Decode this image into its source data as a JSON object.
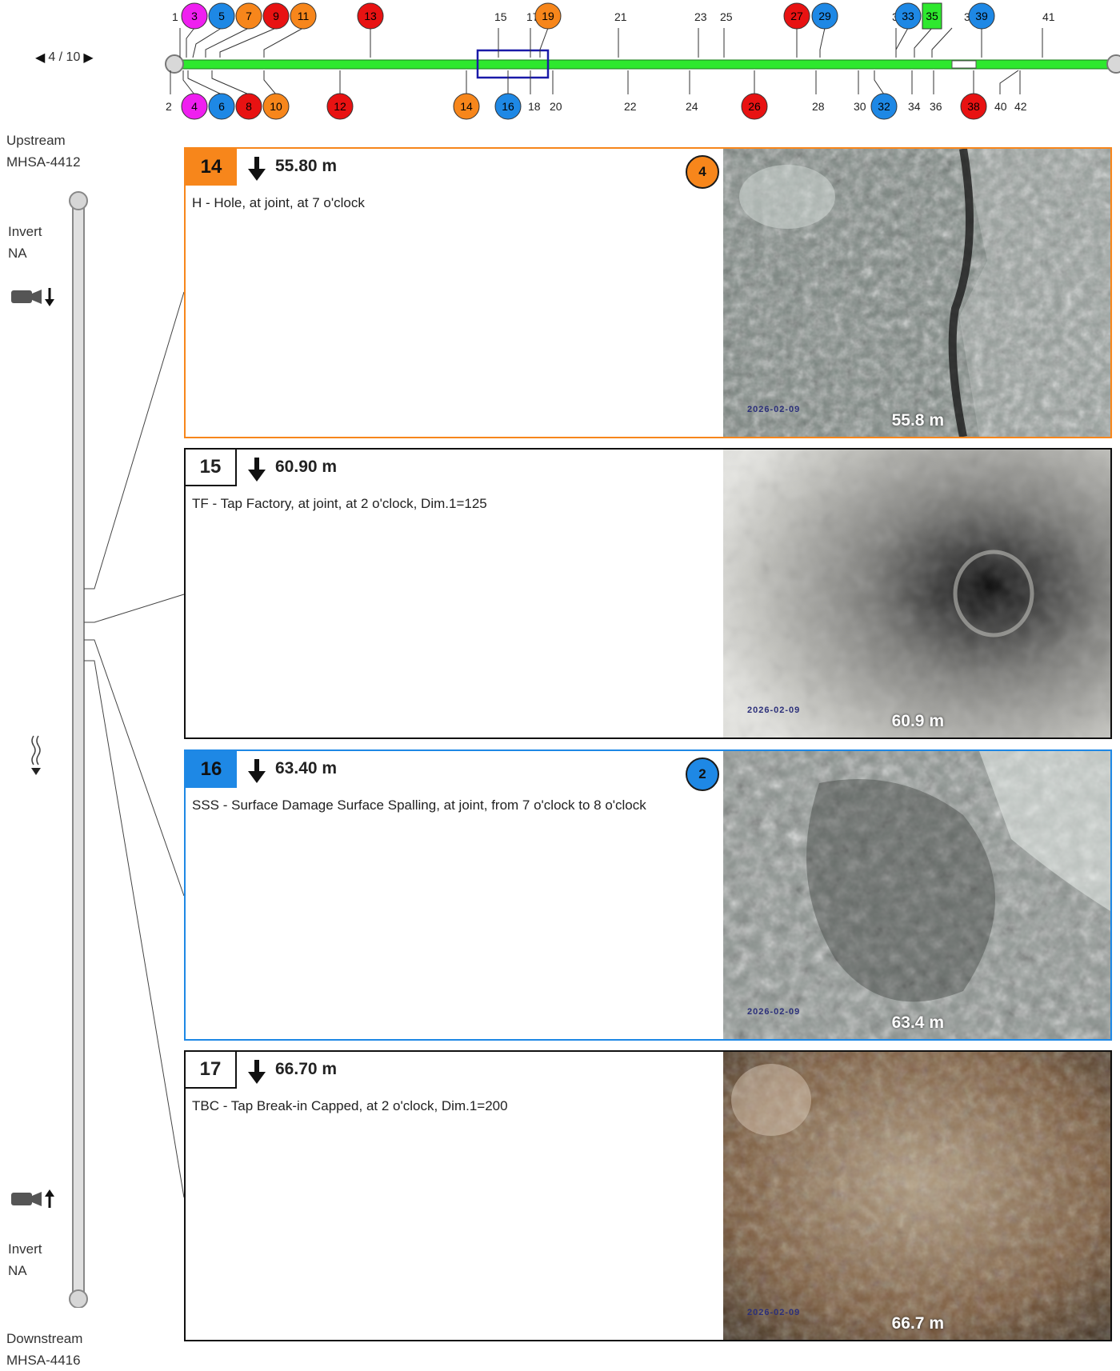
{
  "pager": {
    "prev": "◀",
    "text": "4 / 10",
    "next": "▶"
  },
  "upstream": {
    "label": "Upstream",
    "id": "MHSA-4412"
  },
  "downstream": {
    "label": "Downstream",
    "id": "MHSA-4416"
  },
  "invert_top": {
    "label": "Invert",
    "value": "NA"
  },
  "invert_bottom": {
    "label": "Invert",
    "value": "NA"
  },
  "timeline": {
    "top_labels": [
      "1",
      "3",
      "5",
      "7",
      "9",
      "11",
      "13",
      "15",
      "17",
      "19",
      "21",
      "23",
      "25",
      "27",
      "29",
      "31",
      "33",
      "35",
      "37",
      "39",
      "41"
    ],
    "bottom_labels": [
      "2",
      "4",
      "6",
      "8",
      "10",
      "12",
      "14",
      "16",
      "18",
      "20",
      "22",
      "24",
      "26",
      "28",
      "30",
      "32",
      "34",
      "36",
      "38",
      "40",
      "42"
    ],
    "colors": {
      "magenta": "#ef1ff0",
      "blue": "#1e88e5",
      "orange": "#f7861b",
      "red": "#e81212",
      "green": "#2ee82e"
    }
  },
  "observations": [
    {
      "num": "14",
      "distance": "55.80 m",
      "description": "H - Hole, at joint, at 7 o'clock",
      "grade": "4",
      "photo_distance": "55.8 m",
      "photo_date": "2026-02-09",
      "color": "#f7861b"
    },
    {
      "num": "15",
      "distance": "60.90 m",
      "description": "TF - Tap Factory, at joint, at 2 o'clock, Dim.1=125",
      "grade": "",
      "photo_distance": "60.9 m",
      "photo_date": "2026-02-09",
      "color": ""
    },
    {
      "num": "16",
      "distance": "63.40 m",
      "description": "SSS - Surface Damage Surface Spalling, at joint, from 7 o'clock to 8 o'clock",
      "grade": "2",
      "photo_distance": "63.4 m",
      "photo_date": "2026-02-09",
      "color": "#1e88e5"
    },
    {
      "num": "17",
      "distance": "66.70 m",
      "description": "TBC - Tap Break-in Capped, at 2 o'clock, Dim.1=200",
      "grade": "",
      "photo_distance": "66.7 m",
      "photo_date": "2026-02-09",
      "color": ""
    }
  ]
}
